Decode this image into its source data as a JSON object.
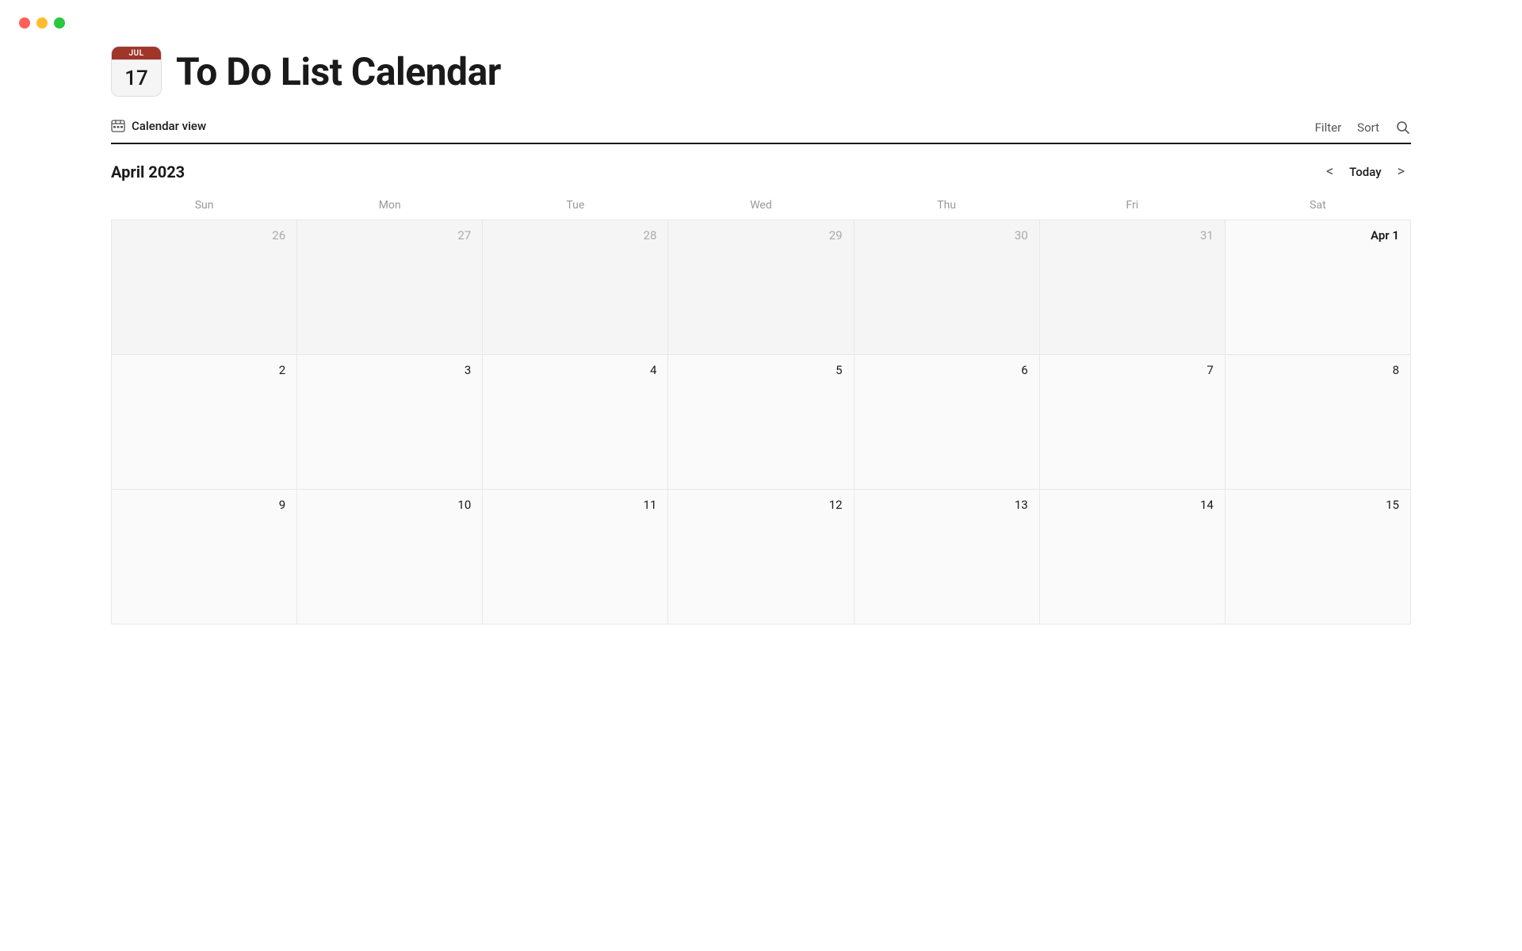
{
  "window": {
    "traffic_lights": [
      "red",
      "yellow",
      "green"
    ]
  },
  "header": {
    "icon": {
      "month_label": "JUL",
      "day_number": "17"
    },
    "title": "To Do List Calendar"
  },
  "toolbar": {
    "view_tab_label": "Calendar view",
    "filter_label": "Filter",
    "sort_label": "Sort"
  },
  "calendar": {
    "month_title": "April 2023",
    "today_label": "Today",
    "nav_prev": "‹",
    "nav_next": "›",
    "day_headers": [
      "Sun",
      "Mon",
      "Tue",
      "Wed",
      "Thu",
      "Fri",
      "Sat"
    ],
    "weeks": [
      [
        {
          "label": "26",
          "type": "other"
        },
        {
          "label": "27",
          "type": "other"
        },
        {
          "label": "28",
          "type": "other"
        },
        {
          "label": "29",
          "type": "other"
        },
        {
          "label": "30",
          "type": "other"
        },
        {
          "label": "31",
          "type": "other"
        },
        {
          "label": "Apr 1",
          "type": "april-first"
        }
      ],
      [
        {
          "label": "2",
          "type": "current"
        },
        {
          "label": "3",
          "type": "current"
        },
        {
          "label": "4",
          "type": "current"
        },
        {
          "label": "5",
          "type": "current"
        },
        {
          "label": "6",
          "type": "current"
        },
        {
          "label": "7",
          "type": "current"
        },
        {
          "label": "8",
          "type": "current"
        }
      ],
      [
        {
          "label": "9",
          "type": "current"
        },
        {
          "label": "10",
          "type": "current"
        },
        {
          "label": "11",
          "type": "current"
        },
        {
          "label": "12",
          "type": "current"
        },
        {
          "label": "13",
          "type": "current"
        },
        {
          "label": "14",
          "type": "current"
        },
        {
          "label": "15",
          "type": "current"
        }
      ]
    ]
  }
}
